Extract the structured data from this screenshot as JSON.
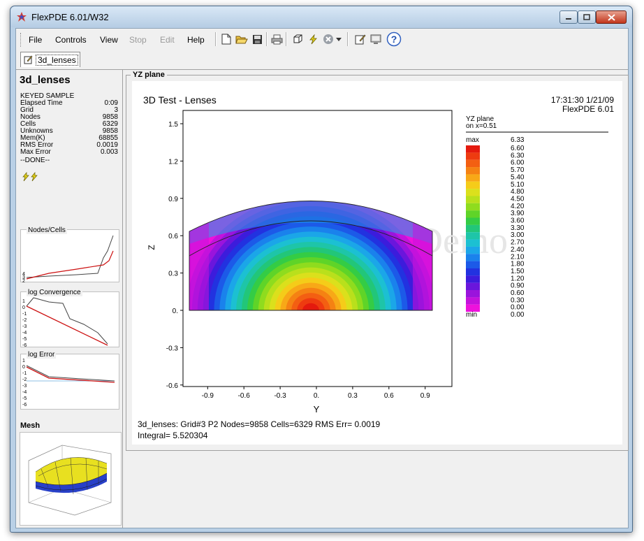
{
  "window": {
    "title": "FlexPDE  6.01/W32"
  },
  "menu": [
    "File",
    "Controls",
    "View",
    "Stop",
    "Edit",
    "Help"
  ],
  "menu_disabled": [
    "Stop",
    "Edit"
  ],
  "toolbar_icons": [
    "new-icon",
    "open-icon",
    "save-icon",
    "print-icon",
    "cube-icon",
    "lightning-icon",
    "stop-circle-icon",
    "dropdown-arrow-icon",
    "edit-icon",
    "monitor-icon",
    "help-icon"
  ],
  "tab": {
    "label": "3d_lenses"
  },
  "left": {
    "title": "3d_lenses",
    "stats": [
      {
        "k": "KEYED SAMPLE",
        "v": ""
      },
      {
        "k": "Elapsed Time",
        "v": "0:09"
      },
      {
        "k": "Grid",
        "v": "3"
      },
      {
        "k": "Nodes",
        "v": "9858"
      },
      {
        "k": "Cells",
        "v": "6329"
      },
      {
        "k": "Unknowns",
        "v": "9858"
      },
      {
        "k": "Mem(K)",
        "v": "68855"
      },
      {
        "k": "RMS Error",
        "v": "0.0019"
      },
      {
        "k": "Max Error",
        "v": "0.003"
      }
    ],
    "done": "--DONE--",
    "graphs": {
      "nodes_cells": {
        "title": "Nodes/Cells",
        "ticks": [
          "4",
          "3",
          "2"
        ]
      },
      "convergence": {
        "title": "log Convergence",
        "ticks": [
          "1",
          "0",
          "-1",
          "-2",
          "-3",
          "-4",
          "-5",
          "-6"
        ]
      },
      "error": {
        "title": "log Error",
        "ticks": [
          "1",
          "0",
          "-1",
          "-2",
          "-3",
          "-4",
          "-5",
          "-6"
        ]
      }
    },
    "mesh_title": "Mesh"
  },
  "plot": {
    "group_title": "YZ plane",
    "title": "3D Test - Lenses",
    "timestamp": "17:31:30 1/21/09",
    "version": "FlexPDE 6.01",
    "legend_title_1": "YZ plane",
    "legend_title_2": "on x=0.51",
    "watermark": "Demo",
    "xlabel": "Y",
    "ylabel": "Z",
    "xticks": [
      "-0.9",
      "-0.6",
      "-0.3",
      "0.",
      "0.3",
      "0.6",
      "0.9"
    ],
    "yticks": [
      "1.5",
      "1.2",
      "0.9",
      "0.6",
      "0.3",
      "0.",
      "-0.3",
      "-0.6"
    ],
    "legend_max": "max",
    "legend_min": "min",
    "legend_max_value": "6.33",
    "legend_min_value": "0.00",
    "legend_values": [
      "6.60",
      "6.30",
      "6.00",
      "5.70",
      "5.40",
      "5.10",
      "4.80",
      "4.50",
      "4.20",
      "3.90",
      "3.60",
      "3.30",
      "3.00",
      "2.70",
      "2.40",
      "2.10",
      "1.80",
      "1.50",
      "1.20",
      "0.90",
      "0.60",
      "0.30",
      "0.00"
    ],
    "legend_colors": [
      "#e41a0e",
      "#ee3b10",
      "#f35f12",
      "#f58213",
      "#f8a817",
      "#f5cc19",
      "#dbe01c",
      "#b9e01c",
      "#8fdc1e",
      "#5fd428",
      "#34cc45",
      "#22c679",
      "#1ec5a8",
      "#1cc0d2",
      "#1ba6e8",
      "#1a82ec",
      "#1c5ae8",
      "#2232e0",
      "#3c1cdc",
      "#6a16dc",
      "#9a14dc",
      "#c412dc",
      "#ee12dc"
    ],
    "footer_line1": "3d_lenses:  Grid#3  P2  Nodes=9858 Cells=6329 RMS Err= 0.0019",
    "footer_line2": "Integral=  5.520304"
  }
}
